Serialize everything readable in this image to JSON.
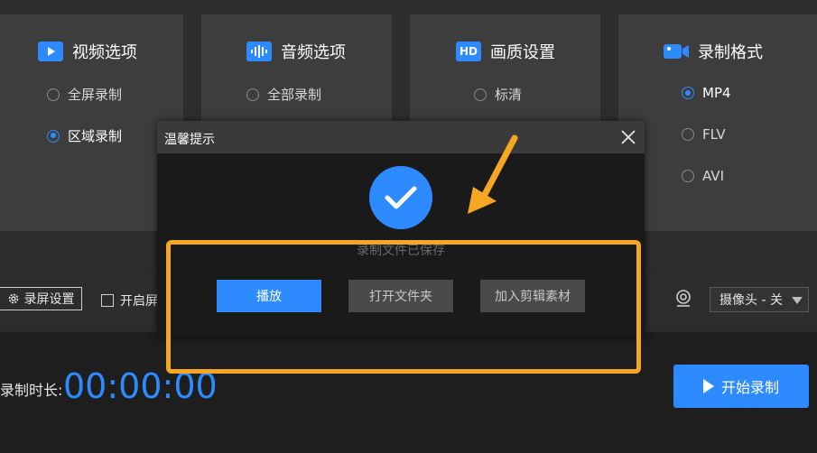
{
  "panels": [
    {
      "title": "视频选项",
      "icon": "video-icon",
      "options": [
        {
          "label": "全屏录制",
          "selected": false
        },
        {
          "label": "区域录制",
          "selected": true
        }
      ]
    },
    {
      "title": "音频选项",
      "icon": "audio-icon",
      "options": [
        {
          "label": "全部录制",
          "selected": false
        }
      ]
    },
    {
      "title": "画质设置",
      "icon": "hd-icon",
      "options": [
        {
          "label": "标清",
          "selected": false
        }
      ]
    },
    {
      "title": "录制格式",
      "icon": "camera-icon",
      "options": [
        {
          "label": "MP4",
          "selected": true
        },
        {
          "label": "FLV",
          "selected": false
        },
        {
          "label": "AVI",
          "selected": false
        }
      ]
    }
  ],
  "hd_badge": "HD",
  "toolbar": {
    "settings_label": "录屏设置",
    "checkbox_label": "开启屏",
    "camera_select": "摄像头 - 关"
  },
  "bottom": {
    "duration_label": "录制时长:",
    "duration_value": "00:00:00",
    "start_label": "开始录制"
  },
  "dialog": {
    "title": "温馨提示",
    "message": "录制文件已保存",
    "buttons": {
      "play": "播放",
      "open_folder": "打开文件夹",
      "add_material": "加入剪辑素材"
    }
  },
  "colors": {
    "accent": "#2e8bff",
    "annotation": "#f5a623"
  }
}
